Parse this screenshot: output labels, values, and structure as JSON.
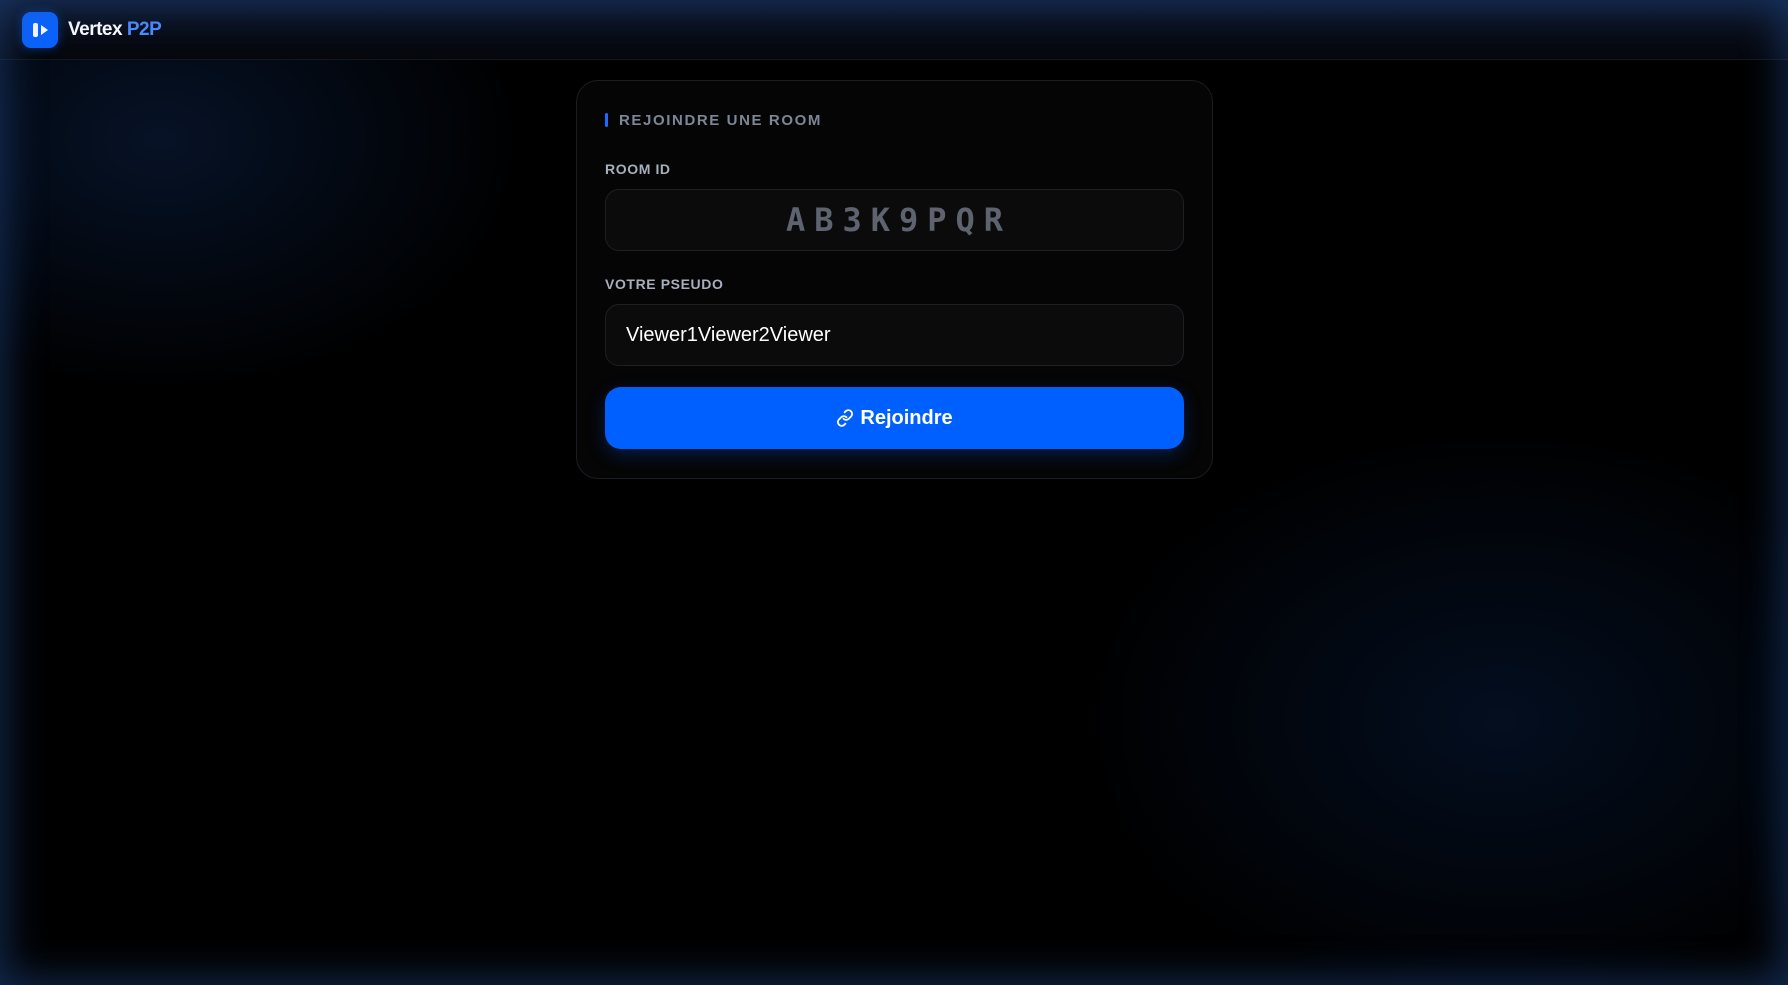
{
  "header": {
    "brand_primary": "Vertex",
    "brand_accent": "P2P"
  },
  "join_card": {
    "section_title": "REJOINDRE UNE ROOM",
    "room_id": {
      "label": "ROOM ID",
      "placeholder": "AB3K9PQR",
      "value": ""
    },
    "pseudo": {
      "label": "VOTRE PSEUDO",
      "value": "Viewer1Viewer2Viewer"
    },
    "join_button": {
      "icon": "link-icon",
      "label": "Rejoindre"
    }
  },
  "colors": {
    "accent": "#0060ff",
    "brand_accent": "#4f8cff",
    "background": "#000000"
  }
}
